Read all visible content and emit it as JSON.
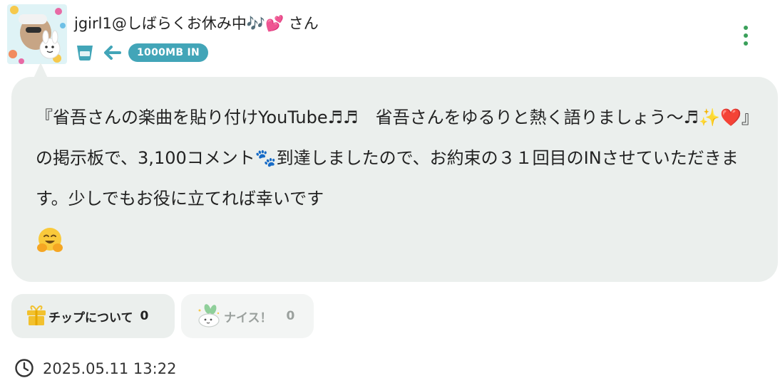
{
  "post": {
    "username": "jgirl1@しばらくお休み中🎶💕 さん",
    "data_badge": "1000MB IN",
    "body_text": "『省吾さんの楽曲を貼り付けYouTube♬♬　省吾さんをゆるりと熱く語りましょう〜♬✨❤️』の掲示板で、3,100コメント🐾到達しましたので、お約束の３１回目のINさせていただきます。少しでもお役に立てれば幸いです",
    "timestamp": "2025.05.11 13:22"
  },
  "actions": {
    "tip_label": "チップについて",
    "tip_count": "0",
    "nice_label": "ナイス！",
    "nice_count": "0"
  },
  "icons": {
    "avatar": "avatar",
    "cup": "cup-icon",
    "arrow": "arrow-left-icon",
    "menu": "more-vertical-icon",
    "hug": "hugging-face-emoji",
    "gift": "gift-icon",
    "rabbit": "rabbit-icon",
    "clock": "clock-icon"
  },
  "colors": {
    "accent": "#42a5b8",
    "menu_dots": "#3aa05a",
    "bubble_bg": "#ebefed",
    "gift": "#f2c12e",
    "rabbit": "#8fcf9a"
  }
}
